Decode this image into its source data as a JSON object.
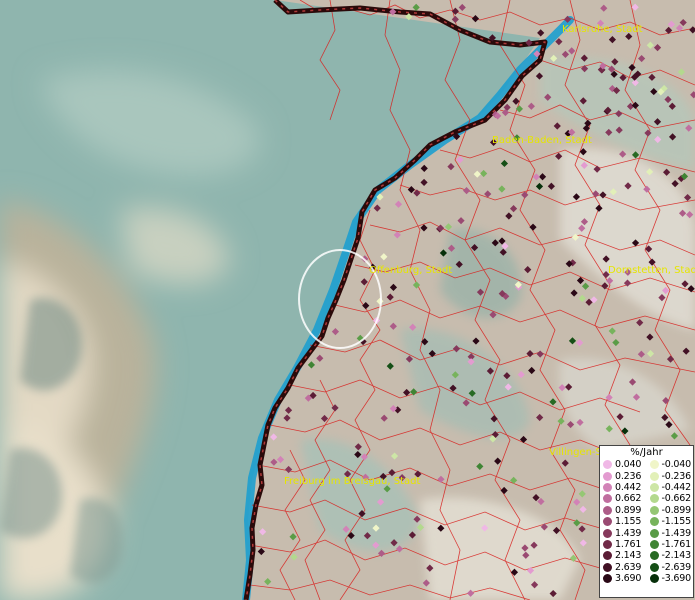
{
  "map": {
    "cities": [
      {
        "name": "Karlsruhe, Stadt"
      },
      {
        "name": "Baden-Baden, Stadt"
      },
      {
        "name": "Offenburg, Stadt"
      },
      {
        "name": "Dornstetten, Stadt"
      },
      {
        "name": "Villingen-Sc"
      },
      {
        "name": "Freiburg im Breisgau, Stadt"
      }
    ],
    "legend": {
      "title": "%/Jahr",
      "rows": [
        {
          "pos": "0.040",
          "pos_color": "#f0b8e6",
          "neg": "-0.040",
          "neg_color": "#f0f5c8"
        },
        {
          "pos": "0.236",
          "pos_color": "#e39bd0",
          "neg": "-0.236",
          "neg_color": "#e2f0b8"
        },
        {
          "pos": "0.442",
          "pos_color": "#d283b7",
          "neg": "-0.442",
          "neg_color": "#cde6a6"
        },
        {
          "pos": "0.662",
          "pos_color": "#c06e9f",
          "neg": "-0.662",
          "neg_color": "#b3d98e"
        },
        {
          "pos": "0.899",
          "pos_color": "#ad5c88",
          "neg": "-0.899",
          "neg_color": "#95c774"
        },
        {
          "pos": "1.155",
          "pos_color": "#9a4a72",
          "neg": "-1.155",
          "neg_color": "#77b35c"
        },
        {
          "pos": "1.439",
          "pos_color": "#86395c",
          "neg": "-1.439",
          "neg_color": "#5a9c47"
        },
        {
          "pos": "1.761",
          "pos_color": "#712a48",
          "neg": "-1.761",
          "neg_color": "#3f8434"
        },
        {
          "pos": "2.143",
          "pos_color": "#5b1c35",
          "neg": "-2.143",
          "neg_color": "#286a24"
        },
        {
          "pos": "2.639",
          "pos_color": "#421125",
          "neg": "-2.639",
          "neg_color": "#154f16"
        },
        {
          "pos": "3.690",
          "pos_color": "#2a0816",
          "neg": "-3.690",
          "neg_color": "#07300a"
        }
      ]
    }
  }
}
